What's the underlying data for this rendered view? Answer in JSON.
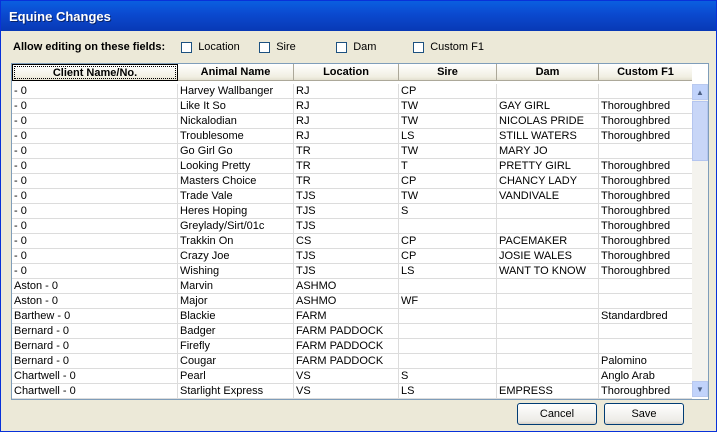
{
  "window": {
    "title": "Equine Changes"
  },
  "fields": {
    "label": "Allow editing on these fields:",
    "options": [
      {
        "label": "Location",
        "checked": false
      },
      {
        "label": "Sire",
        "checked": false
      },
      {
        "label": "Dam",
        "checked": false
      },
      {
        "label": "Custom F1",
        "checked": false
      }
    ]
  },
  "table": {
    "columns": [
      "Client Name/No.",
      "Animal Name",
      "Location",
      "Sire",
      "Dam",
      "Custom F1"
    ],
    "rows": [
      [
        "- 0",
        "Harvey Wallbanger",
        "RJ",
        "CP",
        "",
        ""
      ],
      [
        "- 0",
        "Like It So",
        "RJ",
        "TW",
        "GAY GIRL",
        "Thoroughbred"
      ],
      [
        "- 0",
        "Nickalodian",
        "RJ",
        "TW",
        "NICOLAS PRIDE",
        "Thoroughbred"
      ],
      [
        "- 0",
        "Troublesome",
        "RJ",
        "LS",
        "STILL WATERS",
        "Thoroughbred"
      ],
      [
        "- 0",
        "Go Girl Go",
        "TR",
        "TW",
        "MARY JO",
        ""
      ],
      [
        "- 0",
        "Looking Pretty",
        "TR",
        "T",
        "PRETTY GIRL",
        "Thoroughbred"
      ],
      [
        "- 0",
        "Masters Choice",
        "TR",
        "CP",
        "CHANCY LADY",
        "Thoroughbred"
      ],
      [
        "- 0",
        "Trade Vale",
        "TJS",
        "TW",
        "VANDIVALE",
        "Thoroughbred"
      ],
      [
        "- 0",
        "Heres Hoping",
        "TJS",
        "S",
        "",
        "Thoroughbred"
      ],
      [
        "- 0",
        "Greylady/Sirt/01c",
        "TJS",
        "",
        "",
        "Thoroughbred"
      ],
      [
        "- 0",
        "Trakkin On",
        "CS",
        "CP",
        "PACEMAKER",
        "Thoroughbred"
      ],
      [
        "- 0",
        "Crazy Joe",
        "TJS",
        "CP",
        "JOSIE WALES",
        "Thoroughbred"
      ],
      [
        "- 0",
        "Wishing",
        "TJS",
        "LS",
        "WANT TO KNOW",
        "Thoroughbred"
      ],
      [
        "Aston - 0",
        "Marvin",
        "ASHMO",
        "",
        "",
        ""
      ],
      [
        "Aston - 0",
        "Major",
        "ASHMO",
        "WF",
        "",
        ""
      ],
      [
        "Barthew - 0",
        "Blackie",
        "FARM",
        "",
        "",
        "Standardbred"
      ],
      [
        "Bernard - 0",
        "Badger",
        "FARM PADDOCK",
        "",
        "",
        ""
      ],
      [
        "Bernard - 0",
        "Firefly",
        "FARM PADDOCK",
        "",
        "",
        ""
      ],
      [
        "Bernard - 0",
        "Cougar",
        "FARM PADDOCK",
        "",
        "",
        "Palomino"
      ],
      [
        "Chartwell - 0",
        "Pearl",
        "VS",
        "S",
        "",
        "Anglo Arab"
      ],
      [
        "Chartwell - 0",
        "Starlight Express",
        "VS",
        "LS",
        "EMPRESS",
        "Thoroughbred"
      ]
    ]
  },
  "buttons": {
    "cancel": "Cancel",
    "save": "Save"
  }
}
